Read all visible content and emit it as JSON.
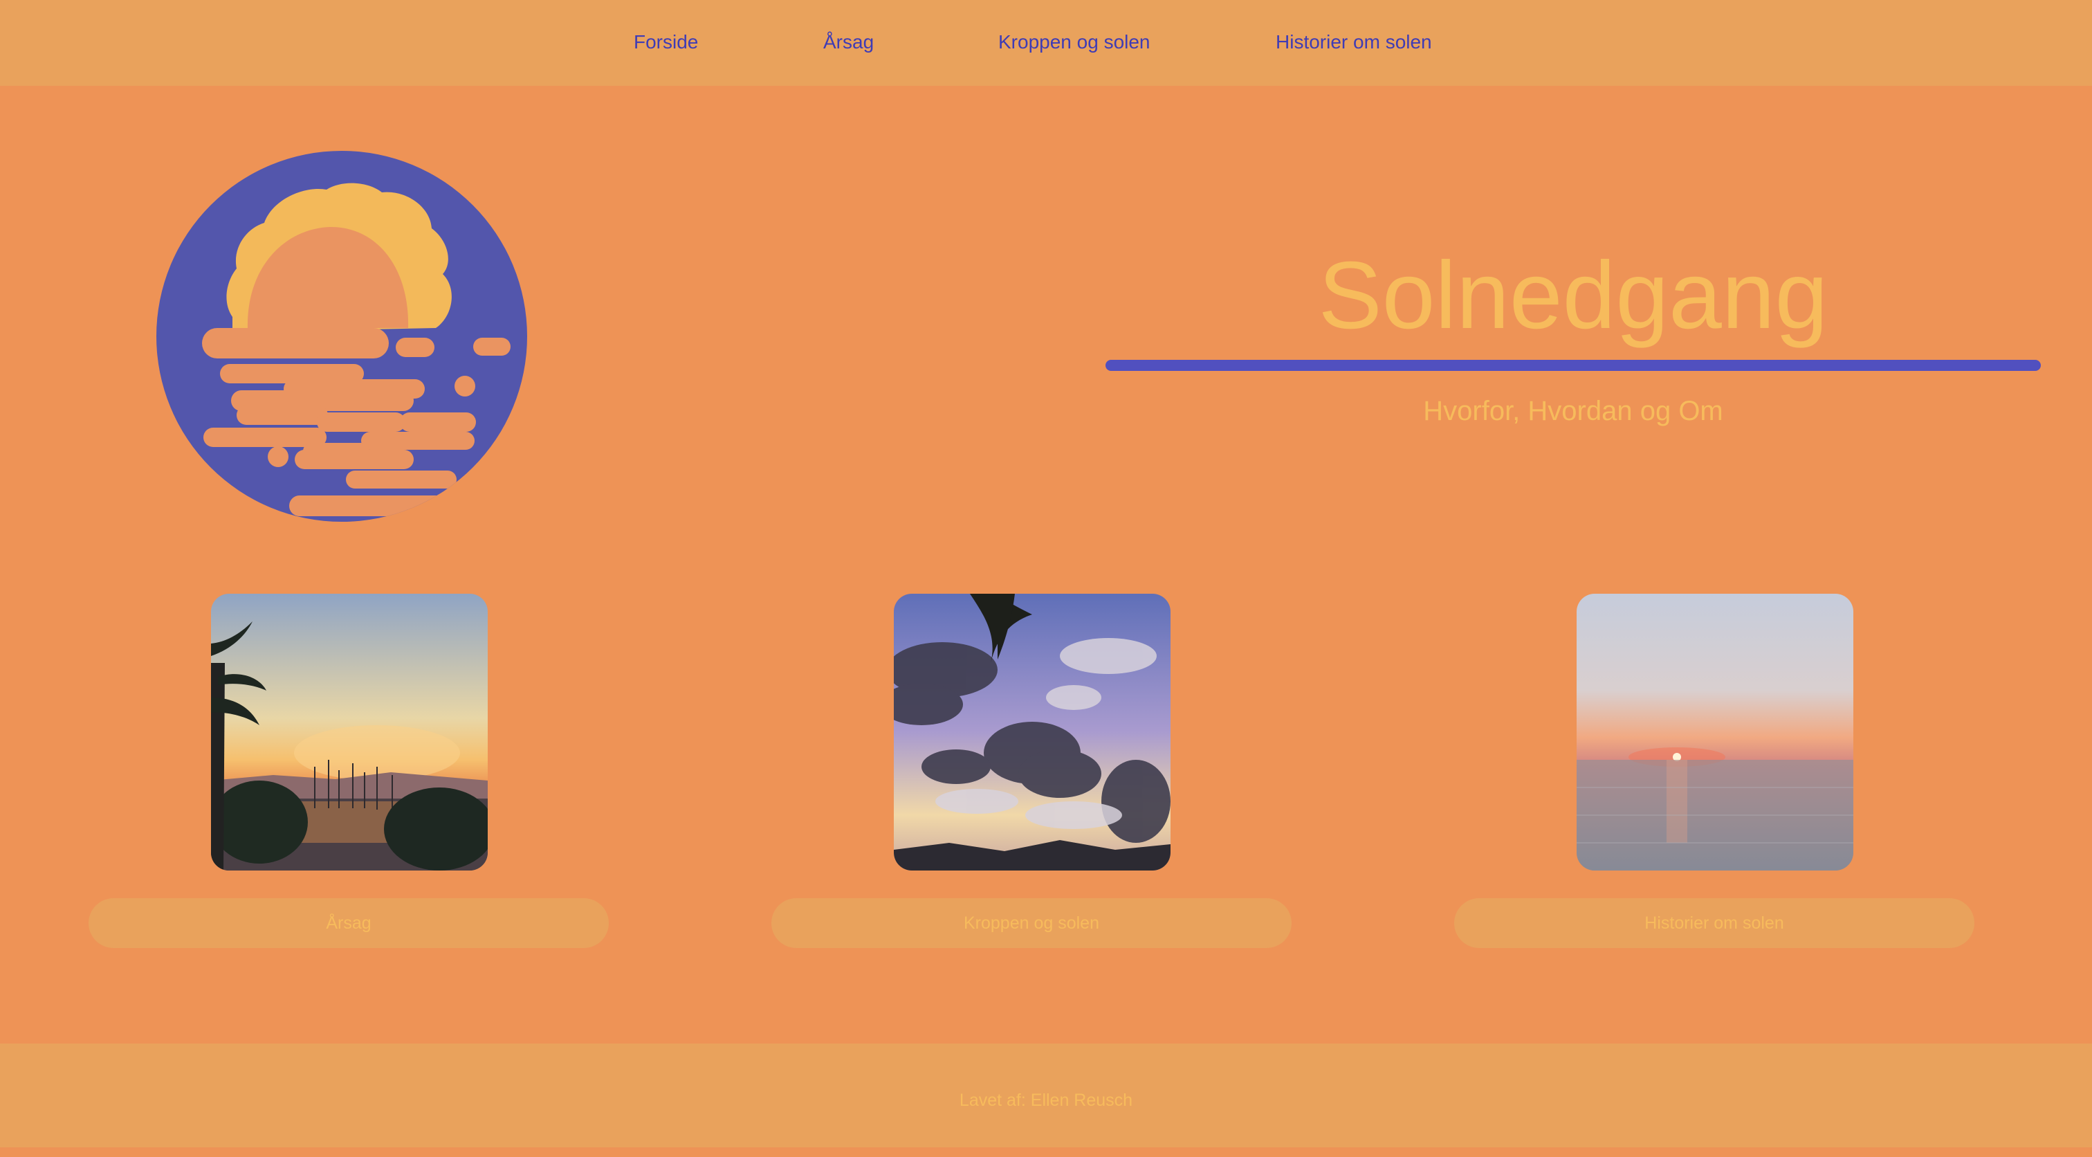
{
  "nav": {
    "items": [
      {
        "label": "Forside"
      },
      {
        "label": "Årsag"
      },
      {
        "label": "Kroppen og solen"
      },
      {
        "label": "Historier om solen"
      }
    ]
  },
  "hero": {
    "title": "Solnedgang",
    "subtitle": "Hvorfor, Hvordan og Om",
    "logo_icon": "sunset-over-water-icon"
  },
  "cards": [
    {
      "button_label": "Årsag",
      "image": "harbor-sunset-photo"
    },
    {
      "button_label": "Kroppen og solen",
      "image": "cloudy-sky-photo"
    },
    {
      "button_label": "Historier om solen",
      "image": "sea-sunset-photo"
    }
  ],
  "footer": {
    "text": "Lavet af: Ellen Reusch"
  },
  "colors": {
    "nav_bg": "#E9A25C",
    "main_bg": "#EE9356",
    "accent_blue": "#5150BF",
    "link_blue": "#3F3CB5",
    "title_yellow": "#F7BB5C"
  }
}
